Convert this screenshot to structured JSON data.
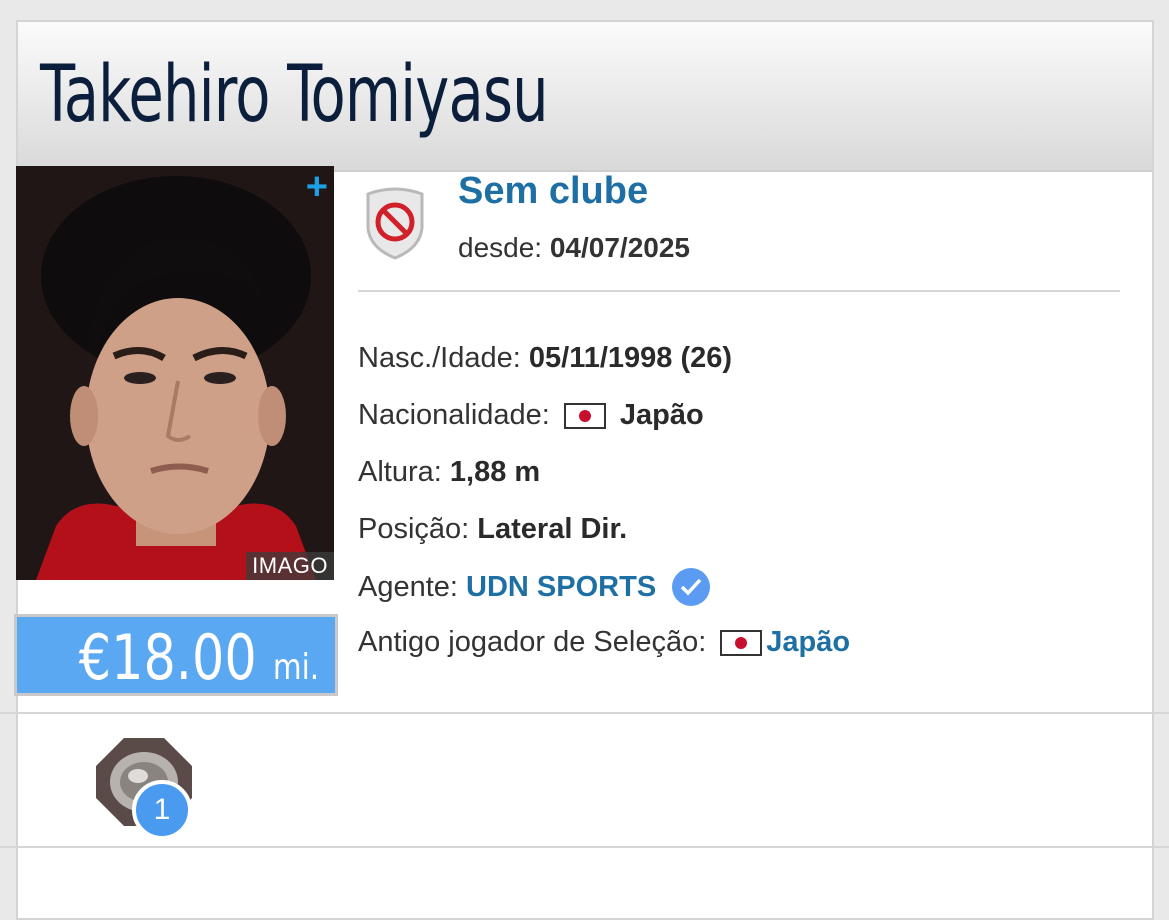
{
  "player": {
    "first_name": "Takehiro",
    "last_name": "Tomiyasu",
    "photo_credit": "IMAGO",
    "market_value": "€18.00",
    "market_value_unit": "mi."
  },
  "club": {
    "name": "Sem clube",
    "since_label": "desde:",
    "since_date": "04/07/2025"
  },
  "info": {
    "birth_label": "Nasc./Idade:",
    "birth_value": "05/11/1998 (26)",
    "nationality_label": "Nacionalidade:",
    "nationality_value": "Japão",
    "height_label": "Altura:",
    "height_value": "1,88 m",
    "position_label": "Posição:",
    "position_value": "Lateral Dir.",
    "agent_label": "Agente:",
    "agent_value": "UDN SPORTS",
    "former_intl_label": "Antigo jogador de Seleção:",
    "former_intl_value": "Japão"
  },
  "trophies": {
    "count": "1"
  },
  "colors": {
    "accent": "#1e6fa3",
    "value_box": "#5aa7f2",
    "badge": "#4a9af0",
    "title": "#0b1f3c"
  },
  "icons": {
    "photo_expand": "plus-icon",
    "club": "no-club-shield-icon",
    "verified": "verified-check-icon",
    "flag": "japan-flag-icon",
    "trophy": "trophy-icon"
  }
}
